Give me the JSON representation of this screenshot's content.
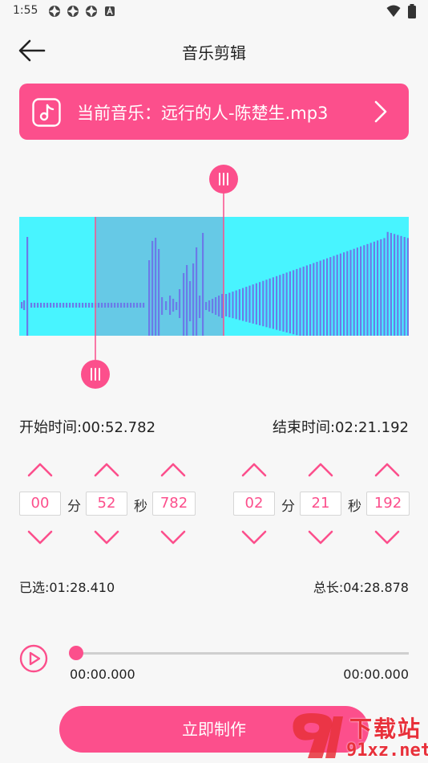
{
  "status": {
    "time": "1:55"
  },
  "header": {
    "title": "音乐剪辑"
  },
  "music": {
    "label": "当前音乐：远行的人-陈楚生.mp3"
  },
  "times": {
    "start_label": "开始时间:00:52.782",
    "end_label": "结束时间:02:21.192",
    "start": {
      "min": "00",
      "sec": "52",
      "ms": "782"
    },
    "end": {
      "min": "02",
      "sec": "21",
      "ms": "192"
    },
    "unit_min": "分",
    "unit_sec": "秒"
  },
  "info": {
    "selected": "已选:01:28.410",
    "total": "总长:04:28.878"
  },
  "player": {
    "current": "00:00.000",
    "duration": "00:00.000",
    "progress": 0
  },
  "actions": {
    "make": "立即制作"
  },
  "watermark": {
    "top": "下载站",
    "bottom": "91xz.net"
  },
  "colors": {
    "accent": "#fc4f8c",
    "wave_bg": "#48f4ff",
    "wave_selected": "#66c9e6",
    "wave_bars": "#6b7be8"
  },
  "icons": [
    "back-arrow-icon",
    "music-note-icon",
    "chevron-right-icon",
    "chevron-up-icon",
    "chevron-down-icon",
    "play-icon",
    "grip-icon",
    "wifi-icon",
    "battery-icon"
  ]
}
